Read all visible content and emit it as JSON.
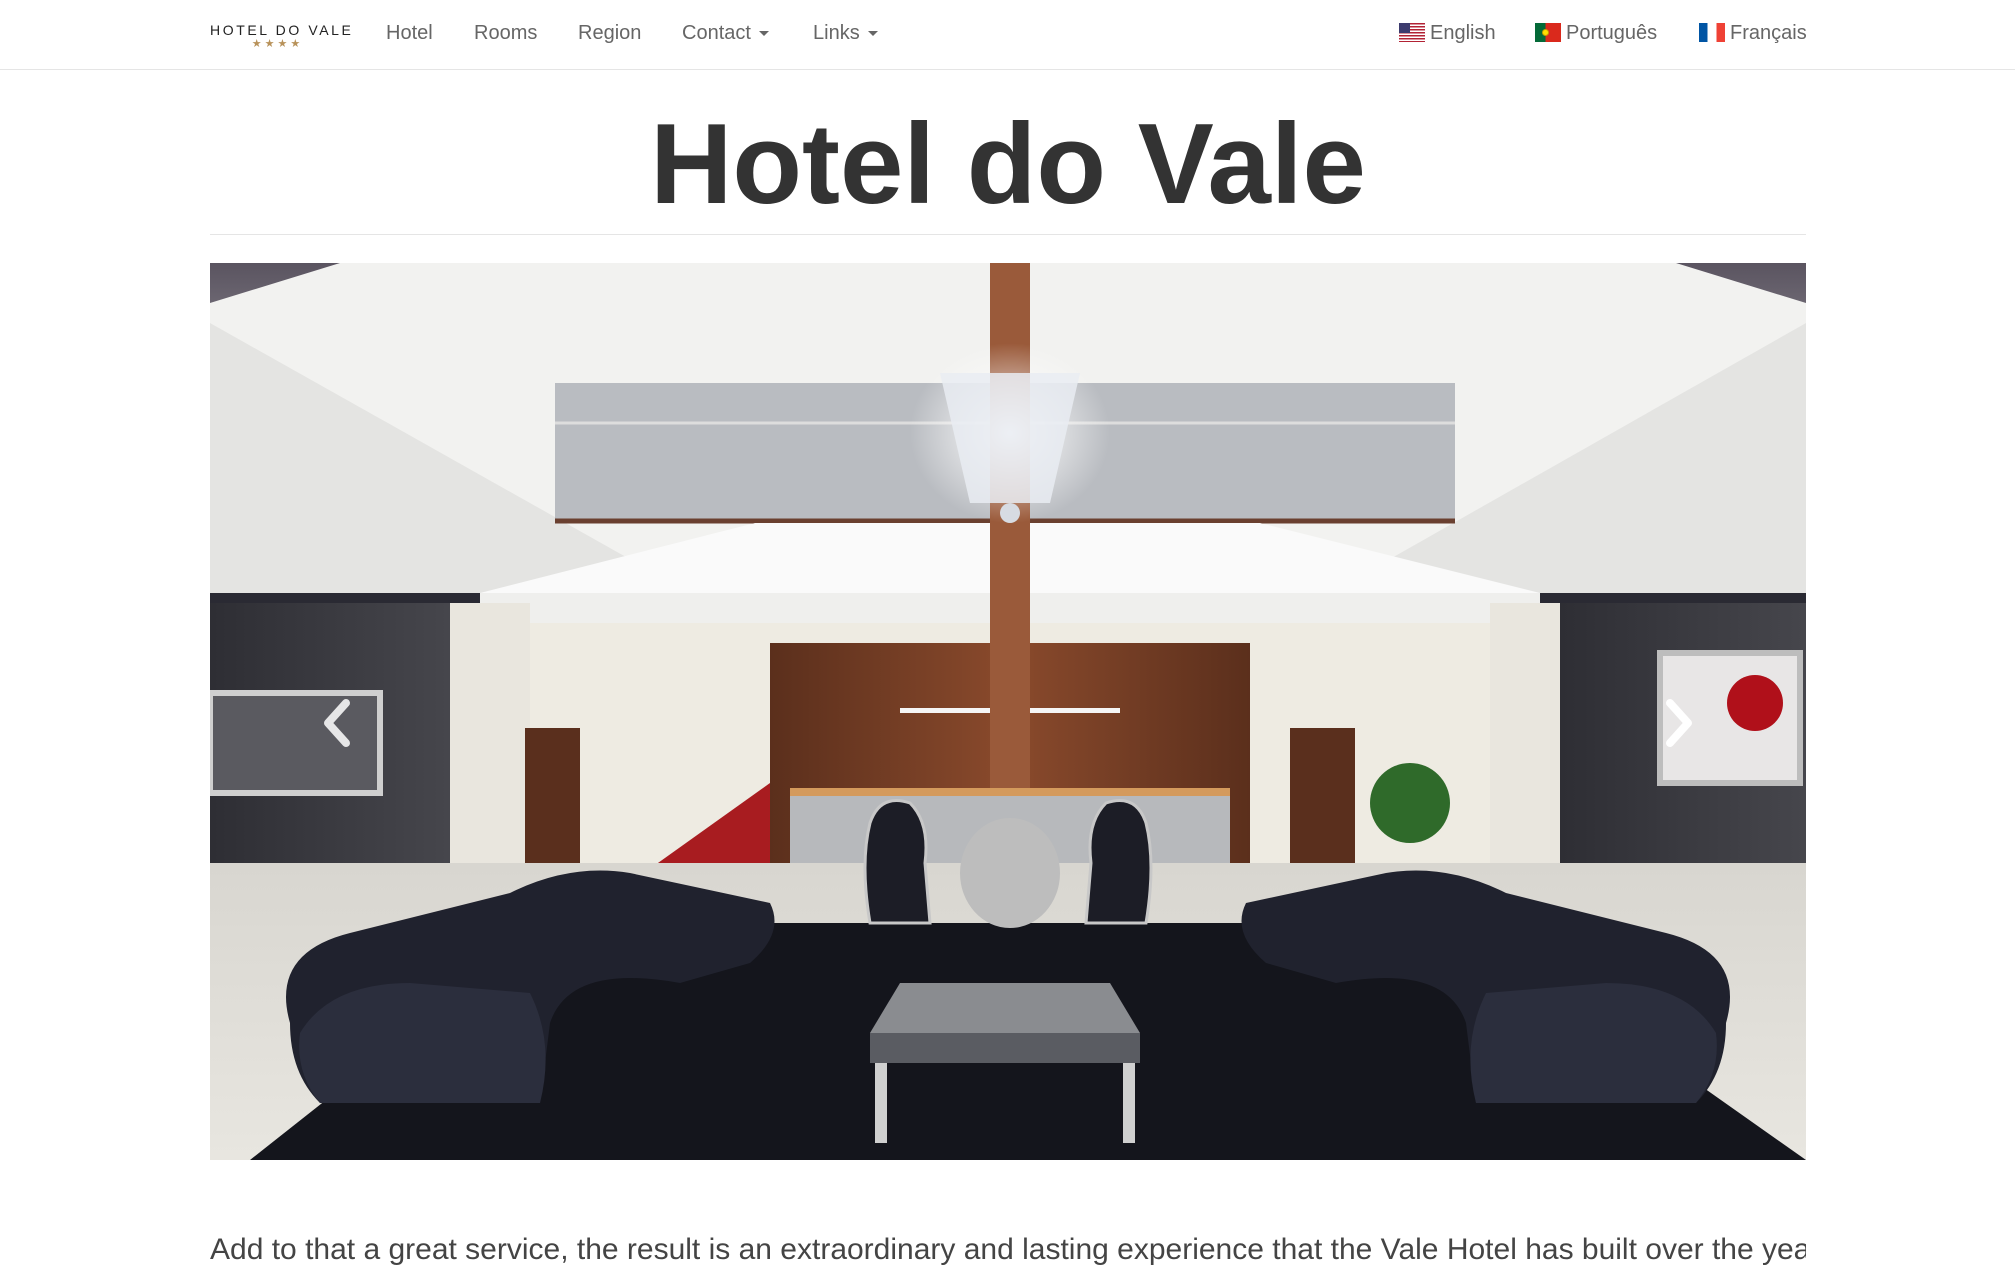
{
  "brand": {
    "name": "HOTEL DO VALE",
    "stars": "★★★★"
  },
  "nav": {
    "items": [
      {
        "label": "Hotel"
      },
      {
        "label": "Rooms"
      },
      {
        "label": "Region"
      },
      {
        "label": "Contact"
      },
      {
        "label": "Links"
      }
    ],
    "languages": [
      {
        "label": "English",
        "flag": "us-flag-icon"
      },
      {
        "label": "Português",
        "flag": "portugal-flag-icon"
      },
      {
        "label": "Français",
        "flag": "france-flag-icon"
      }
    ]
  },
  "page": {
    "title": "Hotel do Vale",
    "intro": "Add to that a great service, the result is an extraordinary and lasting experience that the Vale Hotel has built over the years. We"
  },
  "carousel": {
    "image": "hotel-lobby-photo",
    "prev_icon": "chevron-left-icon",
    "next_icon": "chevron-right-icon"
  }
}
